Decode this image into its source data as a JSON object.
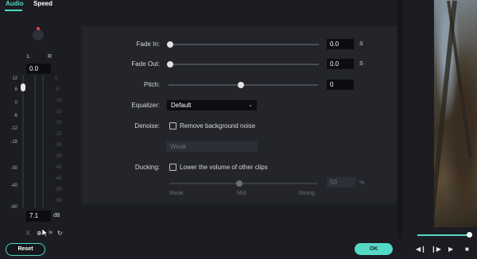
{
  "tabs": [
    {
      "label": "Audio",
      "active": true
    },
    {
      "label": "Speed",
      "active": false
    }
  ],
  "accent_color": "#4fd8c6",
  "mixer": {
    "left_label": "L",
    "right_label": "R",
    "pan_value": "0.0",
    "scale_left": [
      "12",
      "6",
      "0",
      "-6",
      "-12",
      "-18",
      "-30",
      "-40",
      "-60"
    ],
    "scale_right": [
      "0",
      "-5",
      "-10",
      "-15",
      "-20",
      "-25",
      "-30",
      "-35",
      "-40",
      "-45",
      "-50",
      "-55"
    ],
    "volume_value": "7.1",
    "volume_unit": "dB",
    "icons": [
      "skip-back-icon",
      "mute-icon",
      "flag-icon",
      "reset-icon"
    ]
  },
  "settings": {
    "fade_in": {
      "label": "Fade In:",
      "value": "0.0",
      "unit": "S",
      "level": 0
    },
    "fade_out": {
      "label": "Fade Out:",
      "value": "0.0",
      "unit": "S",
      "level": 0
    },
    "pitch": {
      "label": "Pitch:",
      "value": "0",
      "level": 0.5
    },
    "equalizer": {
      "label": "Equalizer:",
      "selected": "Default"
    },
    "denoise": {
      "label": "Denoise:",
      "checkbox_label": "Remove background noise",
      "checked": false,
      "level_placeholder": "Weak"
    },
    "ducking": {
      "label": "Ducking:",
      "checkbox_label": "Lower the volume of other clips",
      "checked": false,
      "value": "50",
      "unit": "%",
      "scale": [
        "Weak",
        "Mid",
        "Strong"
      ],
      "level": 0.5
    }
  },
  "footer": {
    "reset_label": "Reset",
    "ok_label": "OK"
  },
  "player": {
    "progress": 0.93,
    "controls": [
      "step-back-icon",
      "step-forward-icon",
      "play-icon",
      "stop-icon"
    ]
  }
}
